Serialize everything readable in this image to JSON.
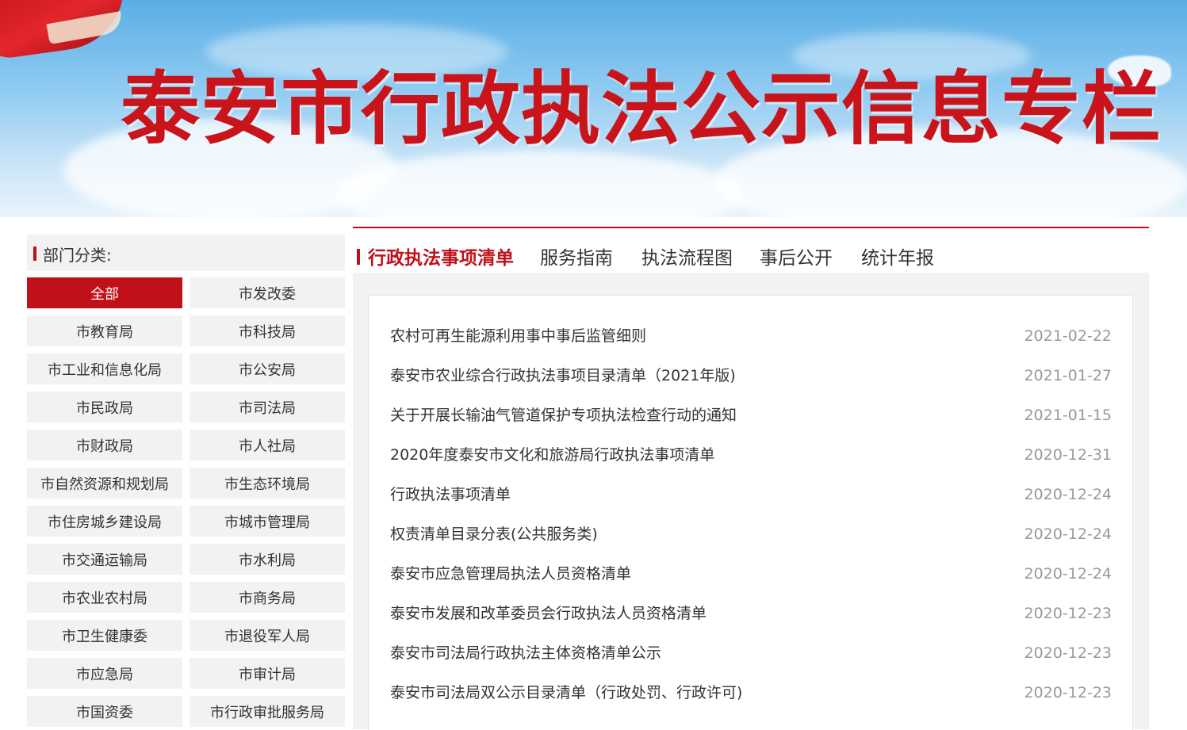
{
  "banner": {
    "title": "泰安市行政执法公示信息专栏"
  },
  "sidebar": {
    "heading": "部门分类:",
    "departments": [
      "全部",
      "市发改委",
      "市教育局",
      "市科技局",
      "市工业和信息化局",
      "市公安局",
      "市民政局",
      "市司法局",
      "市财政局",
      "市人社局",
      "市自然资源和规划局",
      "市生态环境局",
      "市住房城乡建设局",
      "市城市管理局",
      "市交通运输局",
      "市水利局",
      "市农业农村局",
      "市商务局",
      "市卫生健康委",
      "市退役军人局",
      "市应急局",
      "市审计局",
      "市国资委",
      "市行政审批服务局"
    ],
    "active_department": "全部"
  },
  "tabs": [
    {
      "label": "行政执法事项清单",
      "active": true
    },
    {
      "label": "服务指南",
      "active": false
    },
    {
      "label": "执法流程图",
      "active": false
    },
    {
      "label": "事后公开",
      "active": false
    },
    {
      "label": "统计年报",
      "active": false
    }
  ],
  "articles": [
    {
      "title": "农村可再生能源利用事中事后监管细则",
      "date": "2021-02-22"
    },
    {
      "title": "泰安市农业综合行政执法事项目录清单（2021年版)",
      "date": "2021-01-27"
    },
    {
      "title": "关于开展长输油气管道保护专项执法检查行动的通知",
      "date": "2021-01-15"
    },
    {
      "title": "2020年度泰安市文化和旅游局行政执法事项清单",
      "date": "2020-12-31"
    },
    {
      "title": "行政执法事项清单",
      "date": "2020-12-24"
    },
    {
      "title": "权责清单目录分表(公共服务类)",
      "date": "2020-12-24"
    },
    {
      "title": "泰安市应急管理局执法人员资格清单",
      "date": "2020-12-24"
    },
    {
      "title": "泰安市发展和改革委员会行政执法人员资格清单",
      "date": "2020-12-23"
    },
    {
      "title": "泰安市司法局行政执法主体资格清单公示",
      "date": "2020-12-23"
    },
    {
      "title": "泰安市司法局双公示目录清单（行政处罚、行政许可)",
      "date": "2020-12-23"
    }
  ],
  "colors": {
    "accent": "#c0111a",
    "text": "#333333",
    "muted": "#999999",
    "panel": "#f2f2f2"
  }
}
